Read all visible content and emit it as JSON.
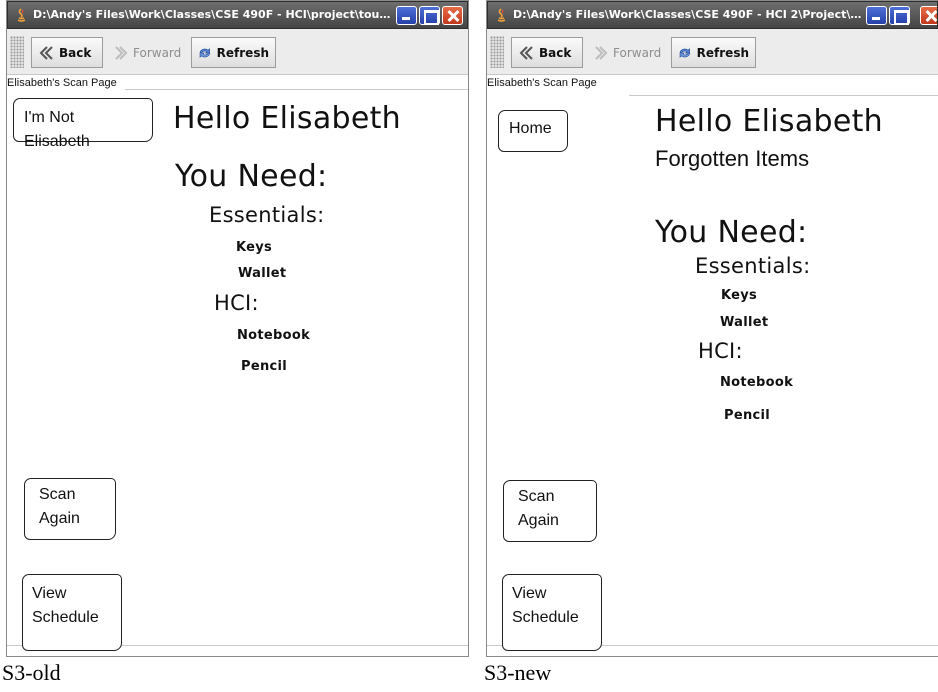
{
  "left": {
    "window_title": "D:\\Andy's Files\\Work\\Classes\\CSE 490F - HCI\\project\\touch scre...",
    "toolbar": {
      "back": "Back",
      "forward": "Forward",
      "refresh": "Refresh"
    },
    "page_label": "Elisabeth's Scan Page",
    "top_button": "I'm Not Elisabeth",
    "greeting": "Hello Elisabeth",
    "you_need": "You Need:",
    "essentials": "Essentials:",
    "essentials_items": [
      "Keys",
      "Wallet"
    ],
    "hci": "HCI:",
    "hci_items": [
      "Notebook",
      "Pencil"
    ],
    "scan_again": [
      "Scan",
      "Again"
    ],
    "view_schedule": [
      "View",
      "Schedule"
    ],
    "caption": "S3-old"
  },
  "right": {
    "window_title": "D:\\Andy's Files\\Work\\Classes\\CSE 490F - HCI 2\\Project\\touch scr...",
    "toolbar": {
      "back": "Back",
      "forward": "Forward",
      "refresh": "Refresh"
    },
    "page_label": "Elisabeth's Scan Page",
    "top_button": "Home",
    "greeting": "Hello Elisabeth",
    "subtitle": "Forgotten Items",
    "you_need": "You Need:",
    "essentials": "Essentials:",
    "essentials_items": [
      "Keys",
      "Wallet"
    ],
    "hci": "HCI:",
    "hci_items": [
      "Notebook",
      "Pencil"
    ],
    "scan_again": [
      "Scan",
      "Again"
    ],
    "view_schedule": [
      "View",
      "Schedule"
    ],
    "caption": "S3-new"
  }
}
